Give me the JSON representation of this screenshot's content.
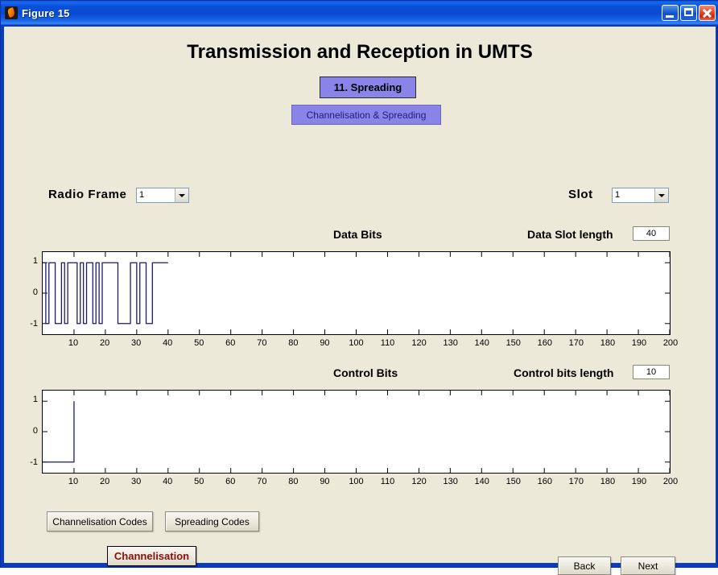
{
  "window": {
    "title": "Figure 15",
    "icon": "matlab-icon",
    "minimize_label": "Minimize",
    "maximize_label": "Maximize",
    "close_label": "Close",
    "background": "#ece9d8",
    "titlebar_color": "#0a4ad2"
  },
  "header": {
    "page_title": "Transmission and Reception in UMTS",
    "step_button": "11. Spreading",
    "section_button": "Channelisation & Spreading",
    "accent_purple": "#8b84e8"
  },
  "controls": {
    "radio_frame_label": "Radio Frame",
    "radio_frame_value": "1",
    "radio_frame_options": [
      "1"
    ],
    "slot_label": "Slot",
    "slot_value": "1",
    "slot_options": [
      "1"
    ]
  },
  "data_plot": {
    "caption": "Data Bits",
    "length_label": "Data Slot length",
    "length_value": "40"
  },
  "control_plot": {
    "caption": "Control Bits",
    "length_label": "Control bits length",
    "length_value": "10"
  },
  "buttons": {
    "channelisation_codes": "Channelisation Codes",
    "spreading_codes": "Spreading Codes",
    "channelisation": "Channelisation",
    "channelisation_color": "#8a1010",
    "back": "Back",
    "next": "Next"
  },
  "chart_data": [
    {
      "type": "line",
      "name": "data-bits-waveform",
      "title": "Data Bits",
      "xlabel": "",
      "ylabel": "",
      "xlim": [
        0,
        200
      ],
      "ylim": [
        -1.35,
        1.35
      ],
      "grid": false,
      "legend": "none",
      "line_color": "#1a1a6e",
      "xticks": [
        10,
        20,
        30,
        40,
        50,
        60,
        70,
        80,
        90,
        100,
        110,
        120,
        130,
        140,
        150,
        160,
        170,
        180,
        190,
        200
      ],
      "xtick_labels": [
        "10",
        "20",
        "30",
        "40",
        "50",
        "60",
        "70",
        "80",
        "90",
        "100",
        "110",
        "120",
        "130",
        "140",
        "150",
        "160",
        "170",
        "180",
        "190",
        "200"
      ],
      "yticks": [
        -1,
        0,
        1
      ],
      "ytick_labels": [
        "-1",
        "0",
        "1"
      ],
      "waveform_note": "Binary NRZ data bits, amplitude +1 / -1, bit index 0 to 40, flat (no trace) beyond 40",
      "bit_index": [
        0,
        1,
        2,
        3,
        4,
        5,
        6,
        7,
        8,
        9,
        10,
        11,
        12,
        13,
        14,
        15,
        16,
        17,
        18,
        19,
        20,
        21,
        22,
        23,
        24,
        25,
        26,
        27,
        28,
        29,
        30,
        31,
        32,
        33,
        34,
        35,
        36,
        37,
        38,
        39
      ],
      "bit_values": [
        1,
        -1,
        1,
        1,
        -1,
        -1,
        1,
        -1,
        1,
        1,
        1,
        -1,
        1,
        -1,
        1,
        1,
        -1,
        1,
        -1,
        1,
        1,
        1,
        1,
        1,
        -1,
        -1,
        -1,
        -1,
        1,
        1,
        -1,
        1,
        1,
        -1,
        -1,
        1,
        1,
        1,
        1,
        1
      ]
    },
    {
      "type": "line",
      "name": "control-bits-waveform",
      "title": "Control Bits",
      "xlabel": "",
      "ylabel": "",
      "xlim": [
        0,
        200
      ],
      "ylim": [
        -1.35,
        1.35
      ],
      "grid": false,
      "legend": "none",
      "line_color": "#1a1a6e",
      "xticks": [
        10,
        20,
        30,
        40,
        50,
        60,
        70,
        80,
        90,
        100,
        110,
        120,
        130,
        140,
        150,
        160,
        170,
        180,
        190,
        200
      ],
      "xtick_labels": [
        "10",
        "20",
        "30",
        "40",
        "50",
        "60",
        "70",
        "80",
        "90",
        "100",
        "110",
        "120",
        "130",
        "140",
        "150",
        "160",
        "170",
        "180",
        "190",
        "200"
      ],
      "yticks": [
        -1,
        0,
        1
      ],
      "ytick_labels": [
        "-1",
        "0",
        "1"
      ],
      "waveform_note": "Control bits held at -1 for bit index 0 to 10, then rising edge to +1 at index 10; no trace beyond",
      "bit_index": [
        0,
        1,
        2,
        3,
        4,
        5,
        6,
        7,
        8,
        9
      ],
      "bit_values": [
        -1,
        -1,
        -1,
        -1,
        -1,
        -1,
        -1,
        -1,
        -1,
        -1
      ]
    }
  ]
}
